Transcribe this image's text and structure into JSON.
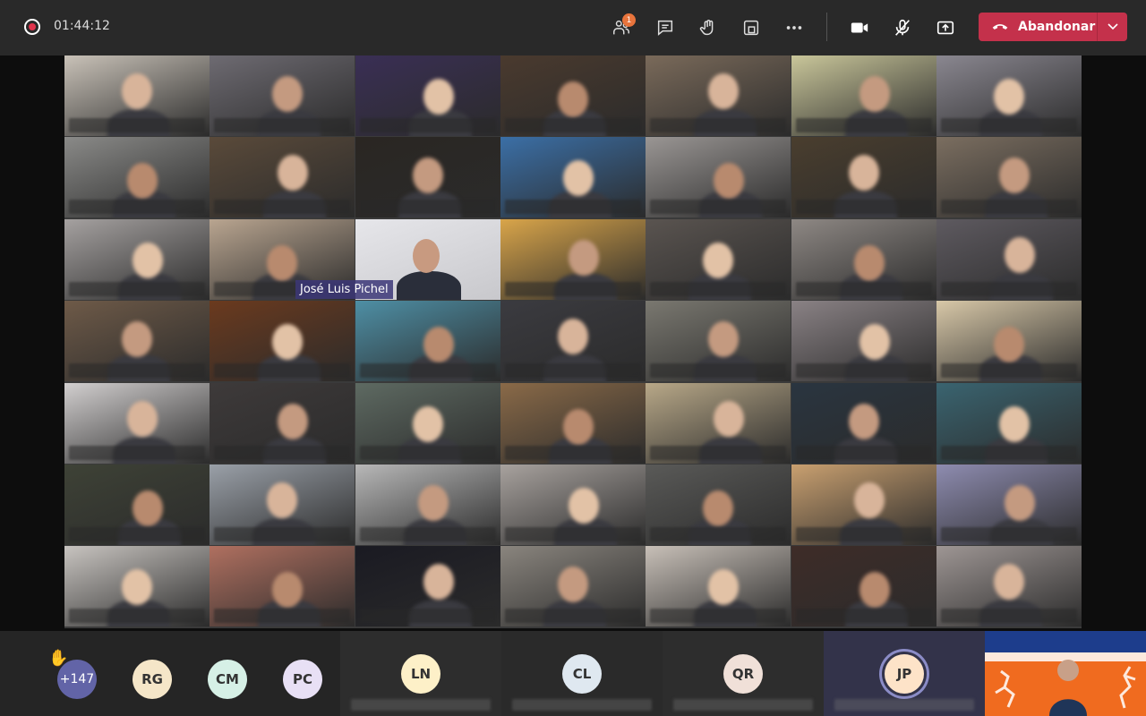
{
  "topbar": {
    "recording_time": "01:44:12",
    "participants_badge": "1",
    "leave_label": "Abandonar",
    "leave_color": "#c4314b"
  },
  "icons": [
    "recording-icon",
    "participants-icon",
    "chat-icon",
    "raise-hand-icon",
    "breakout-icon",
    "more-options-icon",
    "camera-icon",
    "mic-off-icon",
    "share-screen-icon",
    "phone-icon",
    "chevron-down-icon"
  ],
  "stage": {
    "spotlight_name": "José Luis Pichel"
  },
  "bottom": {
    "overflow_count": "+147",
    "avatars": [
      "RG",
      "CM",
      "PC"
    ],
    "featured": [
      "LN",
      "CL",
      "QR",
      "JP"
    ],
    "avatar_colors": [
      "#f5e6c8",
      "#d6f0e6",
      "#e8e0f5",
      "#fdf0c8",
      "#dfe8f0",
      "#f0e0d8",
      "#fde3c8"
    ]
  }
}
